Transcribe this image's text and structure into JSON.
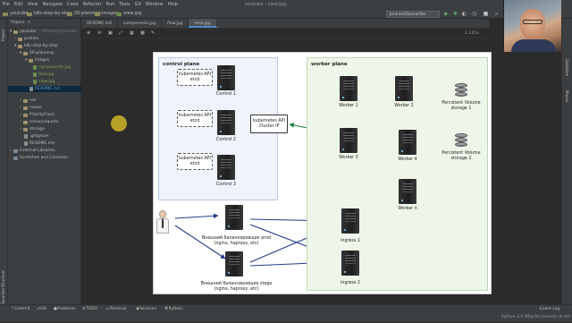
{
  "menu": [
    "File",
    "Edit",
    "View",
    "Navigate",
    "Code",
    "Refactor",
    "Run",
    "Tools",
    "Git",
    "Window",
    "Help"
  ],
  "window_title": "youtube - view.jpg",
  "breadcrumbs": [
    "youtube",
    "k8s-step-by-step",
    "00-planning",
    "images",
    "view.jpg"
  ],
  "run_config": "jenkins/Dockerfile",
  "editor_tabs": [
    "README.md",
    "components.jpg",
    "flow.jpg",
    "view.jpg"
  ],
  "active_tab": "view.jpg",
  "image_info": "1 135×",
  "project": {
    "header": "Project",
    "root": "youtube",
    "root_path": "~/Projects/youtube",
    "items": [
      {
        "label": "youtube",
        "kind": "folder"
      },
      {
        "label": "jenkins",
        "kind": "folder"
      },
      {
        "label": "k8s-step-by-step",
        "kind": "folder"
      },
      {
        "label": "00-planning",
        "kind": "folder"
      },
      {
        "label": "images",
        "kind": "folder"
      },
      {
        "label": "components.jpg",
        "kind": "img"
      },
      {
        "label": "flow.jpg",
        "kind": "img"
      },
      {
        "label": "view.jpg",
        "kind": "img"
      },
      {
        "label": "README.md",
        "kind": "file"
      },
      {
        "label": "net",
        "kind": "folder"
      },
      {
        "label": "nexus",
        "kind": "folder"
      },
      {
        "label": "PriorityClass",
        "kind": "folder"
      },
      {
        "label": "resourcequota",
        "kind": "folder"
      },
      {
        "label": "storage",
        "kind": "folder"
      },
      {
        "label": ".gitignore",
        "kind": "file"
      },
      {
        "label": "README.md",
        "kind": "file"
      },
      {
        "label": "External Libraries",
        "kind": "folder"
      },
      {
        "label": "Scratches and Consoles",
        "kind": "folder"
      }
    ]
  },
  "diagram": {
    "control_plane_title": "control plane",
    "worker_plane_title": "worker plane",
    "api_label_1": "kubernetes API",
    "api_label_2": "etcd",
    "controls": [
      "Control 1",
      "Control 2",
      "Control 3"
    ],
    "service_box": [
      "kubernetes API",
      "Cluster IP"
    ],
    "workers": [
      "Worker 1",
      "Worker 2",
      "Worker 3",
      "Worker 4",
      "Worker n"
    ],
    "storage": [
      [
        "Percistent Volume",
        "storage 1"
      ],
      [
        "Percistent Volume",
        "storage 2"
      ]
    ],
    "balancers": [
      [
        "Внешний балансировщик prod",
        "(nginx, haproxy, etc)"
      ],
      [
        "Внешний балансировщик stage",
        "(nginx, haproxy, etc)"
      ]
    ],
    "ingress": [
      "ingress 1",
      "ingress 2"
    ]
  },
  "left_strip": [
    "Project",
    "Structure",
    "Favorites"
  ],
  "right_strip": [
    "Database",
    "Maven"
  ],
  "statusbar": [
    "Commit",
    "Git",
    "Problems",
    "TODO",
    "Terminal",
    "Services",
    "Python Console"
  ],
  "event_log": "Event Log",
  "bottom_right": "Python 3.8 (MacOsConnect)  ⚙ net"
}
